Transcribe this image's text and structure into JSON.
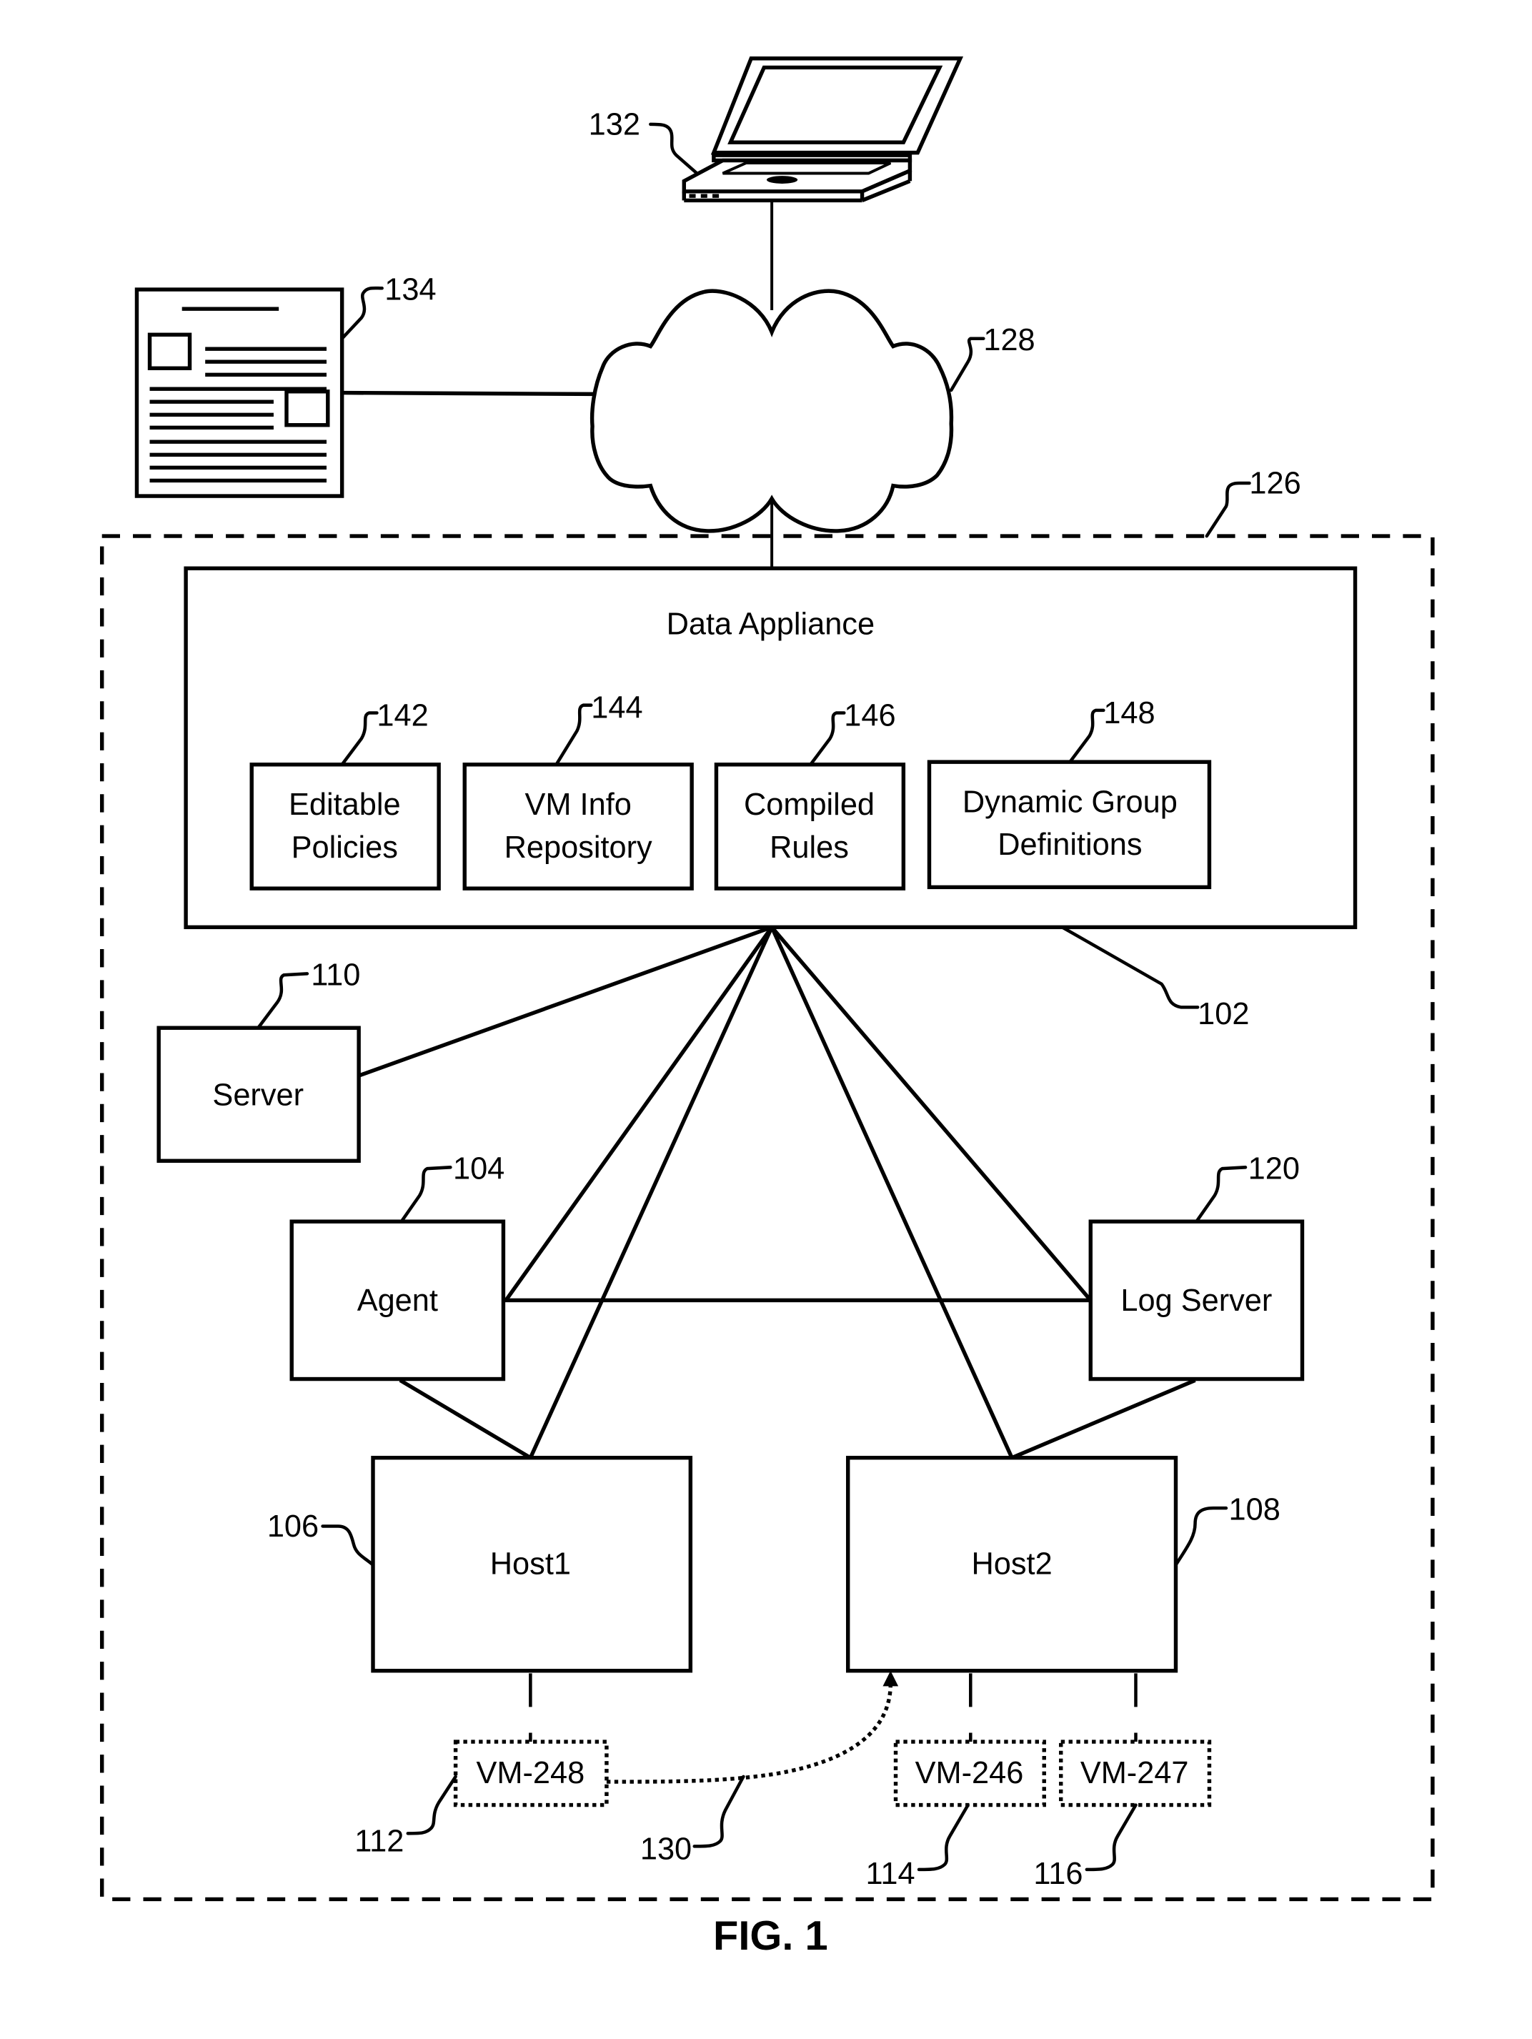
{
  "figure": {
    "caption": "FIG. 1",
    "enclosure_ref": "126",
    "network": {
      "ref": "128",
      "icon": "cloud-icon"
    },
    "client": {
      "ref": "132",
      "icon": "laptop-icon"
    },
    "document": {
      "ref": "134",
      "icon": "document-icon"
    },
    "data_appliance": {
      "title": "Data Appliance",
      "ref": "102",
      "components": [
        {
          "lines": [
            "Editable",
            "Policies"
          ],
          "ref": "142"
        },
        {
          "lines": [
            "VM Info",
            "Repository"
          ],
          "ref": "144"
        },
        {
          "lines": [
            "Compiled",
            "Rules"
          ],
          "ref": "146"
        },
        {
          "lines": [
            "Dynamic Group",
            "Definitions"
          ],
          "ref": "148"
        }
      ]
    },
    "nodes": {
      "server": {
        "label": "Server",
        "ref": "110"
      },
      "agent": {
        "label": "Agent",
        "ref": "104"
      },
      "log_server": {
        "label": "Log Server",
        "ref": "120"
      },
      "host1": {
        "label": "Host1",
        "ref": "106"
      },
      "host2": {
        "label": "Host2",
        "ref": "108"
      }
    },
    "vms": [
      {
        "label": "VM-248",
        "ref": "112"
      },
      {
        "label": "VM-246",
        "ref": "114"
      },
      {
        "label": "VM-247",
        "ref": "116"
      }
    ],
    "migration": {
      "ref": "130"
    }
  }
}
